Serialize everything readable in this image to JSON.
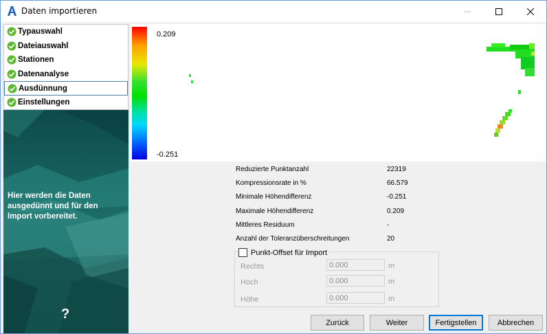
{
  "window": {
    "title": "Daten importieren"
  },
  "steps": [
    {
      "label": "Typauswahl",
      "done": true,
      "active": false
    },
    {
      "label": "Dateiauswahl",
      "done": true,
      "active": false
    },
    {
      "label": "Stationen",
      "done": true,
      "active": false
    },
    {
      "label": "Datenanalyse",
      "done": true,
      "active": false
    },
    {
      "label": "Ausdünnung",
      "done": true,
      "active": true
    },
    {
      "label": "Einstellungen",
      "done": true,
      "active": false
    }
  ],
  "sidebar": {
    "description": "Hier werden die Daten ausgedünnt und für den Import vorbereitet.",
    "help": "?"
  },
  "colorbar": {
    "max": "0.209",
    "min": "-0.251"
  },
  "stats": [
    {
      "label": "Reduzierte Punktanzahl",
      "value": "22319"
    },
    {
      "label": "Kompressionsrate in %",
      "value": "66.579"
    },
    {
      "label": "Minimale Höhendifferenz",
      "value": "-0.251"
    },
    {
      "label": "Maximale Höhendifferenz",
      "value": "0.209"
    },
    {
      "label": "Mittleres Residuum",
      "value": "-"
    },
    {
      "label": "Anzahl der Toleranzüberschreitungen",
      "value": "20"
    }
  ],
  "offset": {
    "title": "Punkt-Offset für Import",
    "checked": false,
    "fields": [
      {
        "label": "Rechts",
        "value": "0.000",
        "unit": "m"
      },
      {
        "label": "Hoch",
        "value": "0.000",
        "unit": "m"
      },
      {
        "label": "Höhe",
        "value": "0.000",
        "unit": "m"
      }
    ]
  },
  "buttons": {
    "back": "Zurück",
    "next": "Weiter",
    "finish": "Fertigstellen",
    "cancel": "Abbrechen"
  },
  "colors": {
    "check_green": "#5cb82e",
    "accent": "#0078d7",
    "teal_panel": "#1e6b66"
  }
}
